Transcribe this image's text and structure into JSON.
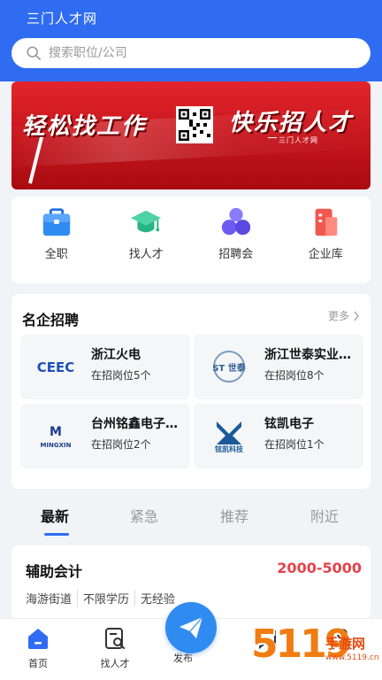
{
  "app": {
    "title": "三门人才网"
  },
  "search": {
    "placeholder": "搜索职位/公司"
  },
  "banner": {
    "left_text": "轻松找工作",
    "right_text": "快乐招人才",
    "sub_text": "三门人才网"
  },
  "quick_links": [
    {
      "label": "全职",
      "icon": "briefcase-icon",
      "color": "#2f8bf0"
    },
    {
      "label": "找人才",
      "icon": "graduation-cap-icon",
      "color": "#2fbf8f"
    },
    {
      "label": "招聘会",
      "icon": "people-icon",
      "color": "#6d5cf0"
    },
    {
      "label": "企业库",
      "icon": "building-icon",
      "color": "#f0574f"
    }
  ],
  "famous": {
    "title": "名企招聘",
    "more": "更多",
    "companies": [
      {
        "name": "浙江火电",
        "jobs": "在招岗位5个",
        "logo_text": "CEEC"
      },
      {
        "name": "浙江世泰实业有限公司",
        "jobs": "在招岗位8个",
        "logo_text": "ST 世泰"
      },
      {
        "name": "台州铭鑫电子有限公司",
        "jobs": "在招岗位2个",
        "logo_text": "MINGXIN"
      },
      {
        "name": "铉凯电子",
        "jobs": "在招岗位1个",
        "logo_text": "铉凯科技"
      }
    ]
  },
  "tabs": [
    "最新",
    "紧急",
    "推荐",
    "附近"
  ],
  "active_tab": "最新",
  "job": {
    "title": "辅助会计",
    "salary": "2000-5000",
    "tags": [
      "海游街道",
      "不限学历",
      "无经验"
    ]
  },
  "tabbar": {
    "home": "首页",
    "find_talent": "找人才",
    "publish": "发布"
  },
  "watermark": {
    "number": "5119",
    "text": "手游网",
    "domain": "www.5119.cn"
  },
  "colors": {
    "primary": "#2f6cf1",
    "salary": "#e5434a",
    "banner": "#d11a21"
  }
}
